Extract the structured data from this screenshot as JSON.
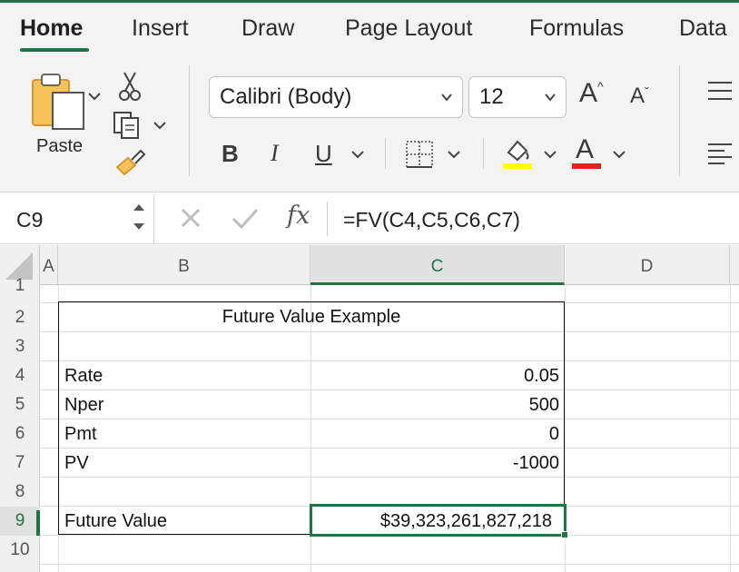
{
  "ribbon": {
    "tabs": [
      "Home",
      "Insert",
      "Draw",
      "Page Layout",
      "Formulas",
      "Data"
    ],
    "active_tab": "Home",
    "paste_label": "Paste",
    "font_name": "Calibri (Body)",
    "font_size": "12",
    "bold_label": "B",
    "italic_label": "I",
    "underline_label": "U",
    "font_color_label": "A",
    "grow_label": "A",
    "shrink_label": "A",
    "colors": {
      "accent": "#217346",
      "highlight": "#ffff00",
      "font_color": "#e0221a"
    }
  },
  "formula_bar": {
    "name_box": "C9",
    "fx_label": "fx",
    "formula": "=FV(C4,C5,C6,C7)"
  },
  "grid": {
    "columns": [
      "A",
      "B",
      "C",
      "D"
    ],
    "active_column": "C",
    "rows": [
      "1",
      "2",
      "3",
      "4",
      "5",
      "6",
      "7",
      "8",
      "9",
      "10"
    ],
    "active_row": "9",
    "title": "Future Value Example",
    "labels": {
      "rate": "Rate",
      "nper": "Nper",
      "pmt": "Pmt",
      "pv": "PV",
      "fv": "Future Value"
    },
    "values": {
      "rate": "0.05",
      "nper": "500",
      "pmt": "0",
      "pv": "-1000",
      "fv": "$39,323,261,827,218"
    }
  }
}
